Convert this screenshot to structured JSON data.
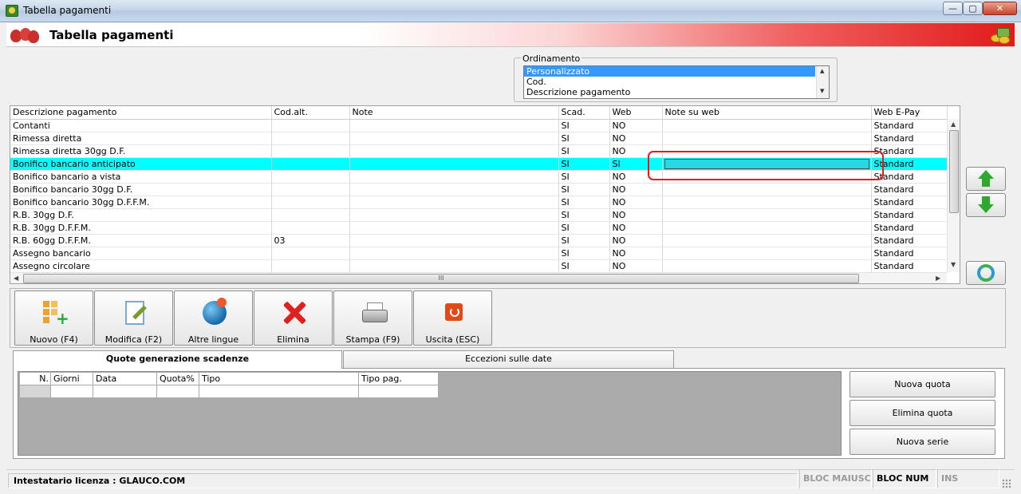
{
  "window": {
    "title": "Tabella pagamenti",
    "controls": {
      "minimize": "—",
      "maximize": "▢",
      "close": "✕"
    }
  },
  "header": {
    "title": "Tabella pagamenti"
  },
  "ordinamento": {
    "legend": "Ordinamento",
    "options": [
      "Personalizzato",
      "Cod.",
      "Descrizione pagamento"
    ],
    "selected": "Personalizzato"
  },
  "grid": {
    "columns": [
      "Descrizione pagamento",
      "Cod.alt.",
      "Note",
      "Scad.",
      "Web",
      "Note su web",
      "Web E-Pay"
    ],
    "rows": [
      {
        "descrizione": "Contanti",
        "codalt": "",
        "note": "",
        "scad": "SI",
        "web": "NO",
        "noteweb": "",
        "epay": "Standard"
      },
      {
        "descrizione": "Rimessa diretta",
        "codalt": "",
        "note": "",
        "scad": "SI",
        "web": "NO",
        "noteweb": "",
        "epay": "Standard"
      },
      {
        "descrizione": "Rimessa diretta 30gg D.F.",
        "codalt": "",
        "note": "",
        "scad": "SI",
        "web": "NO",
        "noteweb": "",
        "epay": "Standard"
      },
      {
        "descrizione": "Bonifico bancario anticipato",
        "codalt": "",
        "note": "",
        "scad": "SI",
        "web": "SI",
        "noteweb": "",
        "epay": "Standard",
        "selected": true
      },
      {
        "descrizione": "Bonifico bancario a vista",
        "codalt": "",
        "note": "",
        "scad": "SI",
        "web": "NO",
        "noteweb": "",
        "epay": "Standard"
      },
      {
        "descrizione": "Bonifico bancario 30gg D.F.",
        "codalt": "",
        "note": "",
        "scad": "SI",
        "web": "NO",
        "noteweb": "",
        "epay": "Standard"
      },
      {
        "descrizione": "Bonifico bancario 30gg D.F.F.M.",
        "codalt": "",
        "note": "",
        "scad": "SI",
        "web": "NO",
        "noteweb": "",
        "epay": "Standard"
      },
      {
        "descrizione": "R.B. 30gg D.F.",
        "codalt": "",
        "note": "",
        "scad": "SI",
        "web": "NO",
        "noteweb": "",
        "epay": "Standard"
      },
      {
        "descrizione": "R.B. 30gg D.F.F.M.",
        "codalt": "",
        "note": "",
        "scad": "SI",
        "web": "NO",
        "noteweb": "",
        "epay": "Standard"
      },
      {
        "descrizione": "R.B. 60gg D.F.F.M.",
        "codalt": "03",
        "note": "",
        "scad": "SI",
        "web": "NO",
        "noteweb": "",
        "epay": "Standard"
      },
      {
        "descrizione": "Assegno bancario",
        "codalt": "",
        "note": "",
        "scad": "SI",
        "web": "NO",
        "noteweb": "",
        "epay": "Standard"
      },
      {
        "descrizione": "Assegno circolare",
        "codalt": "",
        "note": "",
        "scad": "SI",
        "web": "NO",
        "noteweb": "",
        "epay": "Standard"
      }
    ],
    "hscroll_grip": "III",
    "annotation_color": "#e21b1b",
    "highlight_color": "#00ffff"
  },
  "side_buttons": [
    {
      "name": "move-up-button",
      "icon": "arrow-up-icon"
    },
    {
      "name": "move-down-button",
      "icon": "arrow-down-icon"
    },
    {
      "name": "refresh-button",
      "icon": "refresh-icon"
    }
  ],
  "toolbar": {
    "nuovo": "Nuovo (F4)",
    "modifica": "Modifica (F2)",
    "altre_lingue": "Altre lingue",
    "elimina": "Elimina",
    "stampa": "Stampa (F9)",
    "uscita": "Uscita (ESC)"
  },
  "tabs": {
    "quote": "Quote generazione scadenze",
    "eccezioni": "Eccezioni sulle date"
  },
  "subgrid": {
    "columns": [
      "N.",
      "Giorni",
      "Data",
      "Quota%",
      "Tipo",
      "Tipo pag."
    ]
  },
  "quote_buttons": {
    "nuova_quota": "Nuova quota",
    "elimina_quota": "Elimina quota",
    "nuova_serie": "Nuova serie"
  },
  "status": {
    "license": "Intestatario licenza : GLAUCO.COM",
    "caps": "BLOC MAIUSC",
    "num": "BLOC NUM",
    "ins": "INS"
  }
}
